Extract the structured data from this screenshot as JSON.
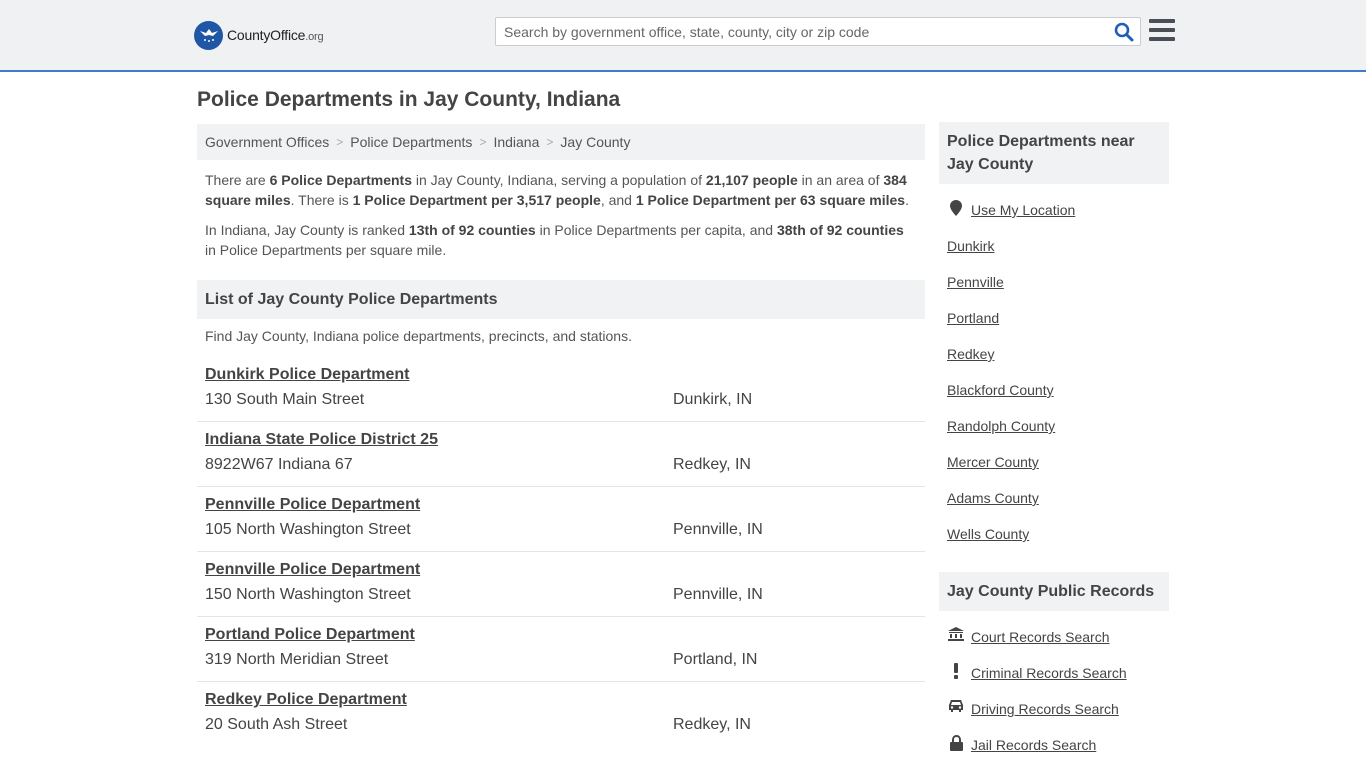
{
  "header": {
    "logo_brand": "CountyOffice",
    "logo_tld": ".org",
    "search_placeholder": "Search by government office, state, county, city or zip code"
  },
  "page": {
    "title": "Police Departments in Jay County, Indiana"
  },
  "breadcrumb": [
    "Government Offices",
    "Police Departments",
    "Indiana",
    "Jay County"
  ],
  "summary": {
    "p1": [
      {
        "t": "There are ",
        "b": false
      },
      {
        "t": "6 Police Departments",
        "b": true
      },
      {
        "t": " in Jay County, Indiana, serving a population of ",
        "b": false
      },
      {
        "t": "21,107 people",
        "b": true
      },
      {
        "t": " in an area of ",
        "b": false
      },
      {
        "t": "384 square miles",
        "b": true
      },
      {
        "t": ". There is ",
        "b": false
      },
      {
        "t": "1 Police Department per 3,517 people",
        "b": true
      },
      {
        "t": ", and ",
        "b": false
      },
      {
        "t": "1 Police Department per 63 square miles",
        "b": true
      },
      {
        "t": ".",
        "b": false
      }
    ],
    "p2": [
      {
        "t": "In Indiana, Jay County is ranked ",
        "b": false
      },
      {
        "t": "13th of 92 counties",
        "b": true
      },
      {
        "t": " in Police Departments per capita, and ",
        "b": false
      },
      {
        "t": "38th of 92 counties",
        "b": true
      },
      {
        "t": " in Police Departments per square mile.",
        "b": false
      }
    ]
  },
  "list": {
    "header": "List of Jay County Police Departments",
    "description": "Find Jay County, Indiana police departments, precincts, and stations.",
    "items": [
      {
        "name": "Dunkirk Police Department",
        "address": "130 South Main Street",
        "city": "Dunkirk, IN"
      },
      {
        "name": "Indiana State Police District 25",
        "address": "8922W67 Indiana 67",
        "city": "Redkey, IN"
      },
      {
        "name": "Pennville Police Department",
        "address": "105 North Washington Street",
        "city": "Pennville, IN"
      },
      {
        "name": "Pennville Police Department",
        "address": "150 North Washington Street",
        "city": "Pennville, IN"
      },
      {
        "name": "Portland Police Department",
        "address": "319 North Meridian Street",
        "city": "Portland, IN"
      },
      {
        "name": "Redkey Police Department",
        "address": "20 South Ash Street",
        "city": "Redkey, IN"
      }
    ]
  },
  "sidebar": {
    "nearby_title": "Police Departments near Jay County",
    "use_location": "Use My Location",
    "nearby_links": [
      "Dunkirk",
      "Pennville",
      "Portland",
      "Redkey",
      "Blackford County",
      "Randolph County",
      "Mercer County",
      "Adams County",
      "Wells County"
    ],
    "records_title": "Jay County Public Records",
    "records_links": [
      {
        "label": "Court Records Search",
        "icon": "courthouse-icon"
      },
      {
        "label": "Criminal Records Search",
        "icon": "exclamation-icon"
      },
      {
        "label": "Driving Records Search",
        "icon": "car-icon"
      },
      {
        "label": "Jail Records Search",
        "icon": "lock-icon"
      }
    ]
  },
  "colors": {
    "header_bg": "#f0f1f2",
    "header_border": "#3d7cc9",
    "logo_blue": "#1f56a5",
    "panel_bg": "#f1f2f3",
    "search_icon": "#1f5fb4"
  }
}
